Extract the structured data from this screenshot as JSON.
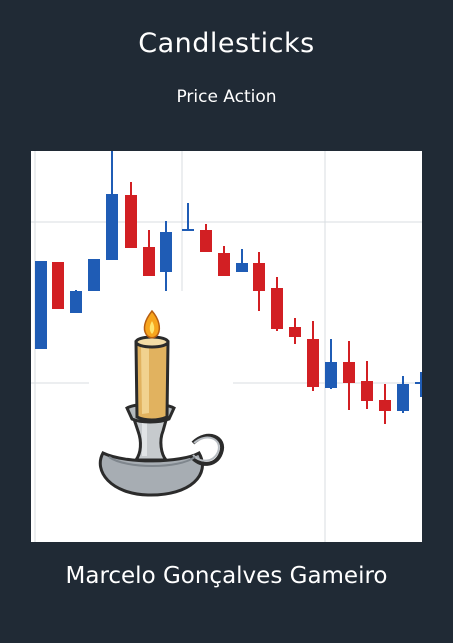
{
  "cover": {
    "title": "Candlesticks",
    "subtitle": "Price Action",
    "author": "Marcelo Gonçalves Gameiro"
  },
  "colors": {
    "background": "#202a35",
    "text": "#ffffff",
    "bullish": "#1f5cb5",
    "bearish": "#d21f23",
    "grid": "#d9dde2",
    "wax": "#e3b35d",
    "candle_holder": "#a8adb2"
  },
  "illustration": {
    "icon": "candle-icon",
    "chart_style": "candlestick"
  },
  "candles": [
    {
      "dir": "up"
    },
    {
      "dir": "down"
    },
    {
      "dir": "up"
    },
    {
      "dir": "up"
    },
    {
      "dir": "up"
    },
    {
      "dir": "down"
    },
    {
      "dir": "down"
    },
    {
      "dir": "up"
    },
    {
      "dir": "doji"
    },
    {
      "dir": "down"
    },
    {
      "dir": "down"
    },
    {
      "dir": "up"
    },
    {
      "dir": "down"
    },
    {
      "dir": "down"
    },
    {
      "dir": "down"
    },
    {
      "dir": "down"
    },
    {
      "dir": "up"
    },
    {
      "dir": "down"
    },
    {
      "dir": "down"
    },
    {
      "dir": "down"
    },
    {
      "dir": "up"
    },
    {
      "dir": "doji"
    }
  ]
}
